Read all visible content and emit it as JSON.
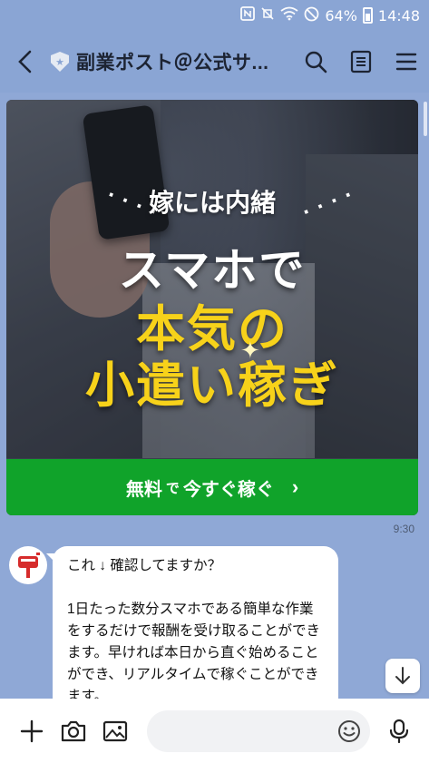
{
  "status_bar": {
    "icons": [
      "nfc-icon",
      "mute-vibrate-icon",
      "wifi-icon",
      "blocked-icon",
      "battery-icon"
    ],
    "battery": "64%",
    "time": "14:48"
  },
  "header": {
    "title": "副業ポスト＠公式サ...",
    "badge_icon": "official-shield-icon",
    "actions": [
      "search-icon",
      "notes-icon",
      "menu-icon"
    ]
  },
  "promo": {
    "subtitle": "嫁には内緒",
    "line1": "スマホで",
    "line2": "本気の",
    "line3": "小遣い稼ぎ",
    "cta_main": "無料",
    "cta_small": "で",
    "cta_rest": "今すぐ稼ぐ",
    "cta_chevron": "›",
    "accent_color": "#f7d21a",
    "cta_color": "#10a32a"
  },
  "message": {
    "time": "9:30",
    "text": "これ ↓ 確認してますか？\n\n1日たった数分スマホである簡単な作業をするだけで報酬を受け取ることができます。早ければ本日から直ぐ始めることができ、リアルタイムで稼ぐことができます。"
  },
  "input": {
    "placeholder": ""
  }
}
